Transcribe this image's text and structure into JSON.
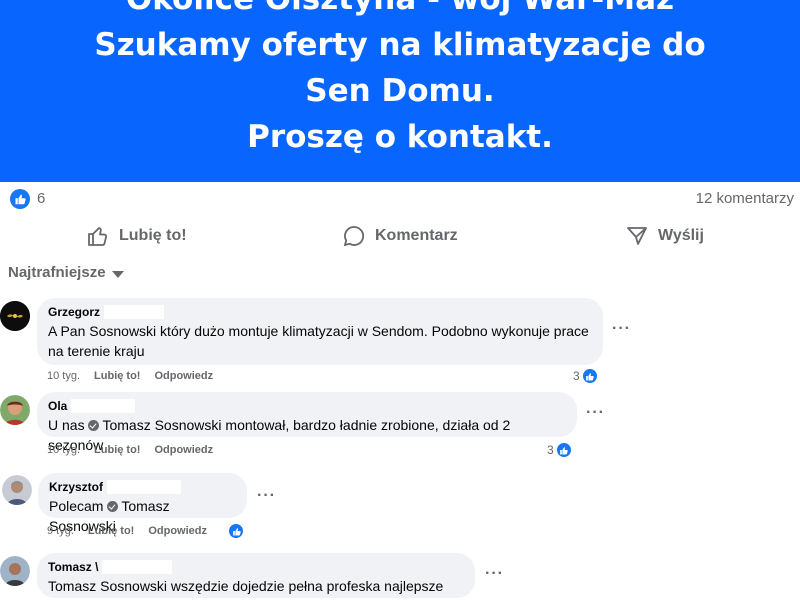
{
  "post": {
    "lines": [
      "Okolice Olsztyna - woj War-Maz",
      "Szukamy oferty na klimatyzacje do",
      "Sen Domu.",
      "Proszę o kontakt."
    ],
    "bg_color": "#0866ff"
  },
  "stats": {
    "likes": "6",
    "comments": "12 komentarzy"
  },
  "actions": {
    "like": "Lubię to!",
    "comment": "Komentarz",
    "share": "Wyślij"
  },
  "sort": {
    "label": "Najtrafniejsze"
  },
  "comments": [
    {
      "author": "Grzegorz",
      "text": "A Pan Sosnowski który dużo montuje klimatyzacji w Sendom. Podobno wykonuje prace na terenie kraju",
      "time": "10 tyg.",
      "like": "Lubię to!",
      "reply": "Odpowiedz",
      "reactions": "3"
    },
    {
      "author": "Ola",
      "mention": "Tomasz Sosnowski",
      "text_before": "U nas",
      "text_after": "montował, bardzo ładnie zrobione, działa od 2 sezonów",
      "time": "10 tyg.",
      "like": "Lubię to!",
      "reply": "Odpowiedz",
      "reactions": "3"
    },
    {
      "author": "Krzysztof",
      "text_before": "Polecam",
      "mention": "Tomasz Sosnowski",
      "time": "9 tyg.",
      "like": "Lubię to!",
      "reply": "Odpowiedz"
    },
    {
      "author": "Tomasz \\",
      "text": "Tomasz Sosnowski wszędzie dojedzie pełna profeska najlepsze ceny"
    }
  ]
}
